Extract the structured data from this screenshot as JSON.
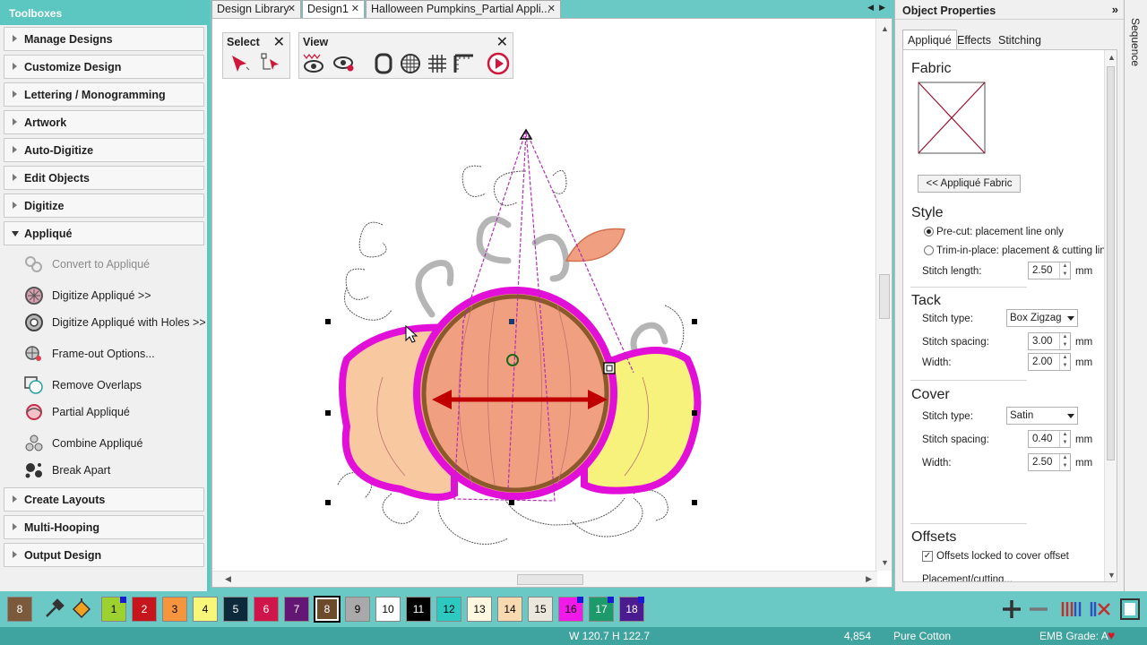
{
  "toolboxes": {
    "title": "Toolboxes",
    "sections": [
      {
        "label": "Manage Designs",
        "open": false
      },
      {
        "label": "Customize Design",
        "open": false
      },
      {
        "label": "Lettering / Monogramming",
        "open": false
      },
      {
        "label": "Artwork",
        "open": false
      },
      {
        "label": "Auto-Digitize",
        "open": false
      },
      {
        "label": "Edit Objects",
        "open": false
      },
      {
        "label": "Digitize",
        "open": false
      },
      {
        "label": "Appliqué",
        "open": true
      },
      {
        "label": "Create Layouts",
        "open": false
      },
      {
        "label": "Multi-Hooping",
        "open": false
      },
      {
        "label": "Output Design",
        "open": false
      }
    ],
    "applique_tools": [
      {
        "label": "Convert to Appliqué",
        "enabled": false
      },
      {
        "label": "Digitize Appliqué >>",
        "enabled": true
      },
      {
        "label": "Digitize Appliqué with Holes >>",
        "enabled": true
      },
      {
        "label": "Frame-out Options...",
        "enabled": true
      },
      {
        "label": "Remove Overlaps",
        "enabled": true
      },
      {
        "label": "Partial Appliqué",
        "enabled": true
      },
      {
        "label": "Combine Appliqué",
        "enabled": true
      },
      {
        "label": "Break Apart",
        "enabled": true
      }
    ]
  },
  "tabs": [
    {
      "label": "Design Library",
      "close": "✕",
      "active": false
    },
    {
      "label": "Design1",
      "close": "✕",
      "active": true
    },
    {
      "label": "Halloween Pumpkins_Partial Appli...",
      "close": "✕",
      "active": false
    }
  ],
  "toolbars": {
    "select": {
      "title": "Select",
      "close": "✕"
    },
    "view": {
      "title": "View",
      "close": "✕"
    }
  },
  "properties": {
    "title": "Object Properties",
    "pin": "»",
    "tabs": [
      {
        "label": "Appliqué",
        "active": true
      },
      {
        "label": "Effects"
      },
      {
        "label": "Stitching"
      }
    ],
    "fabric": {
      "heading": "Fabric",
      "button": "<< Appliqué Fabric"
    },
    "style": {
      "heading": "Style",
      "options": [
        {
          "label": "Pre-cut: placement line only",
          "selected": true
        },
        {
          "label": "Trim-in-place: placement & cutting line",
          "selected": false
        }
      ],
      "stitch_length_label": "Stitch length:",
      "stitch_length_value": "2.50",
      "unit": "mm"
    },
    "tack": {
      "heading": "Tack",
      "stitch_type_label": "Stitch type:",
      "stitch_type_value": "Box Zigzag",
      "spacing_label": "Stitch spacing:",
      "spacing_value": "3.00",
      "width_label": "Width:",
      "width_value": "2.00",
      "unit": "mm"
    },
    "cover": {
      "heading": "Cover",
      "stitch_type_label": "Stitch type:",
      "stitch_type_value": "Satin",
      "spacing_label": "Stitch spacing:",
      "spacing_value": "0.40",
      "width_label": "Width:",
      "width_value": "2.50",
      "unit": "mm"
    },
    "offsets": {
      "heading": "Offsets",
      "locked_label": "Offsets locked to cover offset",
      "locked_checked": true,
      "partial_label": "Placement/cutting..."
    }
  },
  "sequence_label": "Sequence",
  "colorbar": {
    "swatches": [
      {
        "label": "8",
        "bg": "#7a5a3a",
        "fg": "#ffffff",
        "mark": false
      },
      {
        "label": "1",
        "bg": "#9cd12f",
        "fg": "#000000",
        "mark": true
      },
      {
        "label": "2",
        "bg": "#c4161c",
        "fg": "#ffffff",
        "mark": false
      },
      {
        "label": "3",
        "bg": "#f5963f",
        "fg": "#000000",
        "mark": false
      },
      {
        "label": "4",
        "bg": "#f8f77a",
        "fg": "#000000",
        "mark": false
      },
      {
        "label": "5",
        "bg": "#0d2a3b",
        "fg": "#ffffff",
        "mark": false
      },
      {
        "label": "6",
        "bg": "#d0154a",
        "fg": "#ffffff",
        "mark": false
      },
      {
        "label": "7",
        "bg": "#641675",
        "fg": "#ffffff",
        "mark": false
      },
      {
        "label": "8",
        "bg": "#6b4b2c",
        "fg": "#ffffff",
        "mark": false
      },
      {
        "label": "9",
        "bg": "#a9a9a9",
        "fg": "#000000",
        "mark": false
      },
      {
        "label": "10",
        "bg": "#ffffff",
        "fg": "#000000",
        "mark": false
      },
      {
        "label": "11",
        "bg": "#000000",
        "fg": "#ffffff",
        "mark": false
      },
      {
        "label": "12",
        "bg": "#2cc9c0",
        "fg": "#000000",
        "mark": false
      },
      {
        "label": "13",
        "bg": "#fff8e0",
        "fg": "#000000",
        "mark": false
      },
      {
        "label": "14",
        "bg": "#f8d9b0",
        "fg": "#000000",
        "mark": false
      },
      {
        "label": "15",
        "bg": "#ece7dc",
        "fg": "#000000",
        "mark": false
      },
      {
        "label": "16",
        "bg": "#f21ae8",
        "fg": "#000000",
        "mark": true
      },
      {
        "label": "17",
        "bg": "#1c9a6a",
        "fg": "#ffffff",
        "mark": true
      },
      {
        "label": "18",
        "bg": "#4a1c8f",
        "fg": "#ffffff",
        "mark": true
      }
    ]
  },
  "status": {
    "dimensions": "W 120.7 H 122.7",
    "stitches": "4,854",
    "fabric": "Pure Cotton",
    "grade": "EMB Grade: A"
  },
  "colors": {
    "accent": "#5cc6c0",
    "applique_border": "#e10fd8",
    "placement_arrow": "#c00000"
  }
}
